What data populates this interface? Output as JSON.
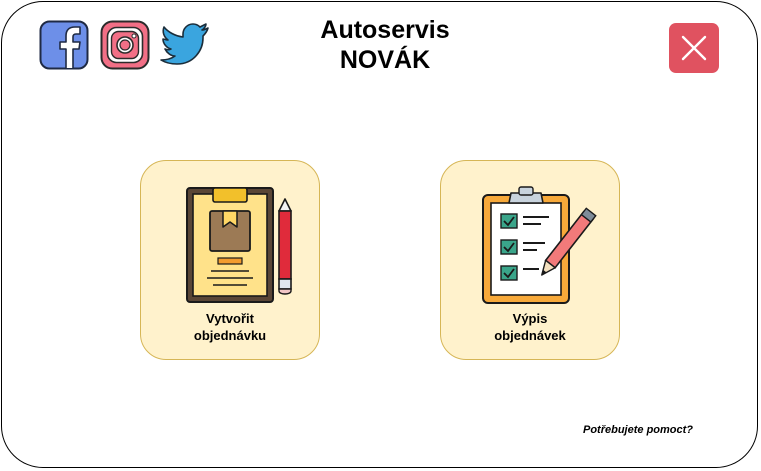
{
  "app": {
    "title_line1": "Autoservis",
    "title_line2": "NOVÁK"
  },
  "social": {
    "icons": [
      "facebook-icon",
      "instagram-icon",
      "twitter-icon"
    ]
  },
  "close": {
    "icon": "close-icon",
    "color": "#e05260"
  },
  "cards": [
    {
      "label_line1": "Vytvořit",
      "label_line2": "objednávku",
      "icon": "clipboard-package-pencil-icon"
    },
    {
      "label_line1": "Výpis",
      "label_line2": "objednávek",
      "icon": "checklist-pencil-icon"
    }
  ],
  "help": {
    "label": "Potřebujete pomoct?"
  },
  "colors": {
    "card_fill": "#fff2cc",
    "card_border": "#d6b656",
    "facebook": "#6d8fe8",
    "instagram": "#f26f86",
    "twitter": "#3aa5df"
  }
}
